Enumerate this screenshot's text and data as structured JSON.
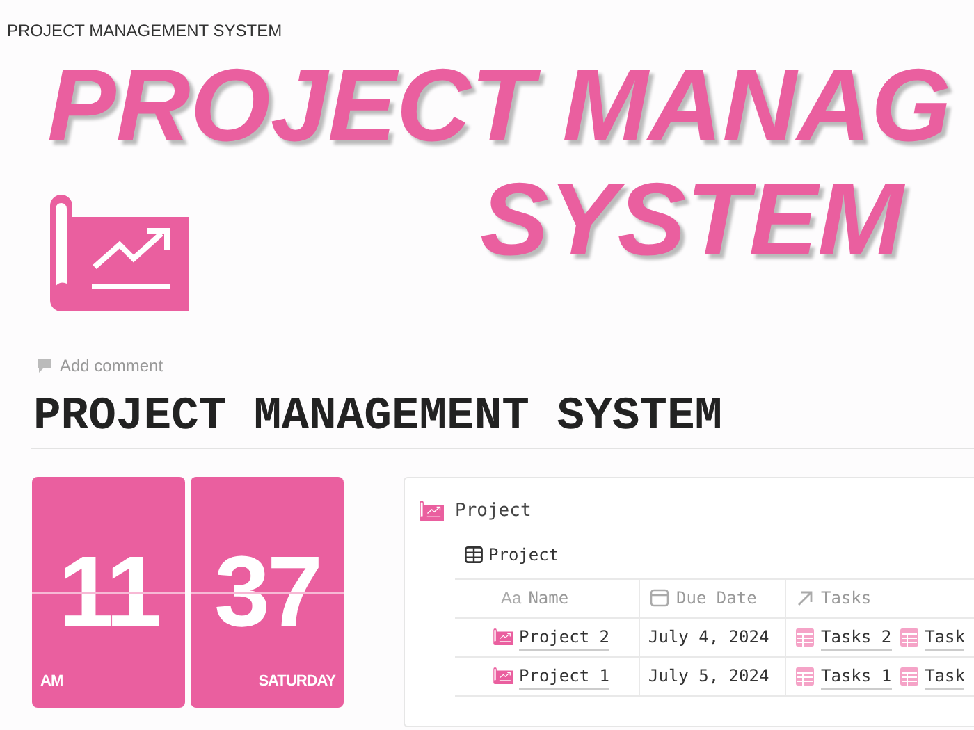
{
  "top_bar": {
    "title": "PROJECT MANAGEMENT SYSTEM"
  },
  "cover": {
    "line_1": "PROJECT MANAG",
    "line_2": "SYSTEM"
  },
  "add_comment": "Add comment",
  "page_title": "PROJECT MANAGEMENT SYSTEM",
  "clock": {
    "hour": "11",
    "minute": "37",
    "period": "AM",
    "day": "SATURDAY"
  },
  "database": {
    "title": "Project",
    "view": "Project",
    "columns": [
      {
        "label": "Name",
        "kind": "title",
        "icon_text": "Aa"
      },
      {
        "label": "Due Date",
        "kind": "date"
      },
      {
        "label": "Tasks",
        "kind": "relation"
      }
    ],
    "rows": [
      {
        "name": "Project 2",
        "due": "July 4, 2024",
        "tasks": [
          "Tasks 2",
          "Task"
        ]
      },
      {
        "name": "Project 1",
        "due": "July 5, 2024",
        "tasks": [
          "Tasks 1",
          "Task"
        ]
      }
    ]
  }
}
